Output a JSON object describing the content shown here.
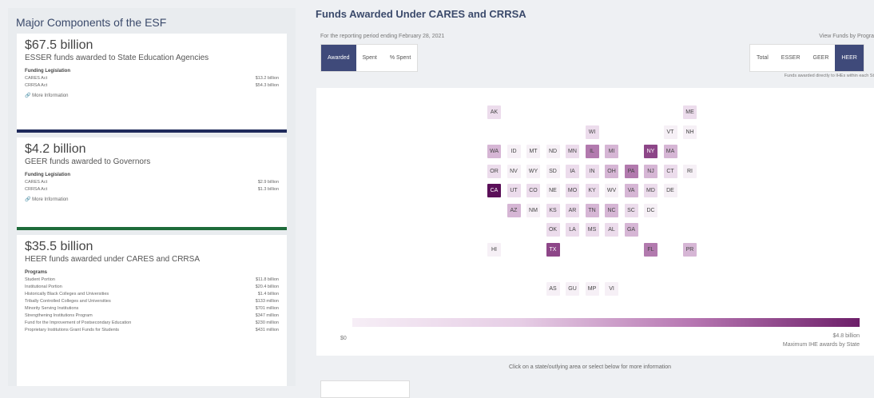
{
  "left": {
    "title": "Major Components of the ESF",
    "cards": [
      {
        "amount": "$67.5 billion",
        "desc": "ESSER funds awarded to State Education Agencies",
        "heading": "Funding Legislation",
        "rows": [
          [
            "CARES Act",
            "$13.2 billion"
          ],
          [
            "CRRSA Act",
            "$54.3 billion"
          ]
        ],
        "more": "More Information",
        "color": "#1f2a5b"
      },
      {
        "amount": "$4.2 billion",
        "desc": "GEER funds awarded to Governors",
        "heading": "Funding Legislation",
        "rows": [
          [
            "CARES Act",
            "$2.9 billion"
          ],
          [
            "CRRSA Act",
            "$1.3 billion"
          ]
        ],
        "more": "More Information",
        "color": "#1e6b3a"
      },
      {
        "amount": "$35.5 billion",
        "desc": "HEER funds awarded under CARES and CRRSA",
        "heading": "Programs",
        "rows": [
          [
            "Student Portion",
            "$11.8 billion"
          ],
          [
            "Institutional Portion",
            "$20.4 billion"
          ],
          [
            "Historically Black Colleges and Universities",
            "$1.4 billion"
          ],
          [
            "Tribally Controlled Colleges and Universities",
            "$133 million"
          ],
          [
            "Minority Serving Institutions",
            "$701 million"
          ],
          [
            "Strengthening Institutions Program",
            "$347 million"
          ],
          [
            "Fund for the Improvement of Postsecondary Education",
            "$230 million"
          ],
          [
            "Proprietary Institutions Grant Funds for Students",
            "$431 million"
          ]
        ],
        "more": "",
        "color": ""
      }
    ]
  },
  "right": {
    "title": "Funds Awarded Under CARES and CRRSA",
    "period": "For the reporting period ending February 28, 2021",
    "view_by": "View Funds by Progra",
    "tabs1": [
      "Awarded",
      "Spent",
      "% Spent"
    ],
    "tabs2": [
      "Total",
      "ESSER",
      "GEER",
      "HEER"
    ],
    "note": "Funds awarded directly to IHEs within each St",
    "legend_min": "$0",
    "legend_max": "$4.8 billion",
    "legend_caption": "Maximum IHE awards by State",
    "instruction": "Click on a state/outlying area or select below for more information"
  },
  "map_tiles": [
    {
      "s": "AK",
      "c": 0,
      "r": 0,
      "l": 1
    },
    {
      "s": "ME",
      "c": 10,
      "r": 0,
      "l": 1
    },
    {
      "s": "WI",
      "c": 5,
      "r": 1,
      "l": 1
    },
    {
      "s": "VT",
      "c": 9,
      "r": 1,
      "l": 0
    },
    {
      "s": "NH",
      "c": 10,
      "r": 1,
      "l": 0
    },
    {
      "s": "WA",
      "c": 0,
      "r": 2,
      "l": 2
    },
    {
      "s": "ID",
      "c": 1,
      "r": 2,
      "l": 0
    },
    {
      "s": "MT",
      "c": 2,
      "r": 2,
      "l": 0
    },
    {
      "s": "ND",
      "c": 3,
      "r": 2,
      "l": 0
    },
    {
      "s": "MN",
      "c": 4,
      "r": 2,
      "l": 1
    },
    {
      "s": "IL",
      "c": 5,
      "r": 2,
      "l": 3
    },
    {
      "s": "MI",
      "c": 6,
      "r": 2,
      "l": 2
    },
    {
      "s": "NY",
      "c": 8,
      "r": 2,
      "l": 4
    },
    {
      "s": "MA",
      "c": 9,
      "r": 2,
      "l": 2
    },
    {
      "s": "OR",
      "c": 0,
      "r": 3,
      "l": 1
    },
    {
      "s": "NV",
      "c": 1,
      "r": 3,
      "l": 0
    },
    {
      "s": "WY",
      "c": 2,
      "r": 3,
      "l": 0
    },
    {
      "s": "SD",
      "c": 3,
      "r": 3,
      "l": 0
    },
    {
      "s": "IA",
      "c": 4,
      "r": 3,
      "l": 1
    },
    {
      "s": "IN",
      "c": 5,
      "r": 3,
      "l": 1
    },
    {
      "s": "OH",
      "c": 6,
      "r": 3,
      "l": 2
    },
    {
      "s": "PA",
      "c": 7,
      "r": 3,
      "l": 3
    },
    {
      "s": "NJ",
      "c": 8,
      "r": 3,
      "l": 2
    },
    {
      "s": "CT",
      "c": 9,
      "r": 3,
      "l": 1
    },
    {
      "s": "RI",
      "c": 10,
      "r": 3,
      "l": 0
    },
    {
      "s": "CA",
      "c": 0,
      "r": 4,
      "l": 5
    },
    {
      "s": "UT",
      "c": 1,
      "r": 4,
      "l": 1
    },
    {
      "s": "CO",
      "c": 2,
      "r": 4,
      "l": 1
    },
    {
      "s": "NE",
      "c": 3,
      "r": 4,
      "l": 0
    },
    {
      "s": "MO",
      "c": 4,
      "r": 4,
      "l": 1
    },
    {
      "s": "KY",
      "c": 5,
      "r": 4,
      "l": 1
    },
    {
      "s": "WV",
      "c": 6,
      "r": 4,
      "l": 0
    },
    {
      "s": "VA",
      "c": 7,
      "r": 4,
      "l": 2
    },
    {
      "s": "MD",
      "c": 8,
      "r": 4,
      "l": 1
    },
    {
      "s": "DE",
      "c": 9,
      "r": 4,
      "l": 0
    },
    {
      "s": "AZ",
      "c": 1,
      "r": 5,
      "l": 2
    },
    {
      "s": "NM",
      "c": 2,
      "r": 5,
      "l": 0
    },
    {
      "s": "KS",
      "c": 3,
      "r": 5,
      "l": 1
    },
    {
      "s": "AR",
      "c": 4,
      "r": 5,
      "l": 1
    },
    {
      "s": "TN",
      "c": 5,
      "r": 5,
      "l": 2
    },
    {
      "s": "NC",
      "c": 6,
      "r": 5,
      "l": 2
    },
    {
      "s": "SC",
      "c": 7,
      "r": 5,
      "l": 1
    },
    {
      "s": "DC",
      "c": 8,
      "r": 5,
      "l": 0
    },
    {
      "s": "OK",
      "c": 3,
      "r": 6,
      "l": 1
    },
    {
      "s": "LA",
      "c": 4,
      "r": 6,
      "l": 1
    },
    {
      "s": "MS",
      "c": 5,
      "r": 6,
      "l": 1
    },
    {
      "s": "AL",
      "c": 6,
      "r": 6,
      "l": 1
    },
    {
      "s": "GA",
      "c": 7,
      "r": 6,
      "l": 2
    },
    {
      "s": "HI",
      "c": 0,
      "r": 7,
      "l": 0
    },
    {
      "s": "TX",
      "c": 3,
      "r": 7,
      "l": 4
    },
    {
      "s": "FL",
      "c": 8,
      "r": 7,
      "l": 3
    },
    {
      "s": "PR",
      "c": 10,
      "r": 7,
      "l": 2
    },
    {
      "s": "AS",
      "c": 3,
      "r": 9,
      "l": 0
    },
    {
      "s": "GU",
      "c": 4,
      "r": 9,
      "l": 0
    },
    {
      "s": "MP",
      "c": 5,
      "r": 9,
      "l": 0
    },
    {
      "s": "VI",
      "c": 6,
      "r": 9,
      "l": 0
    }
  ],
  "tile_colors": [
    "#f6f0f6",
    "#ecdcec",
    "#d6b6d5",
    "#b27aae",
    "#8d4688",
    "#5a0f58"
  ]
}
